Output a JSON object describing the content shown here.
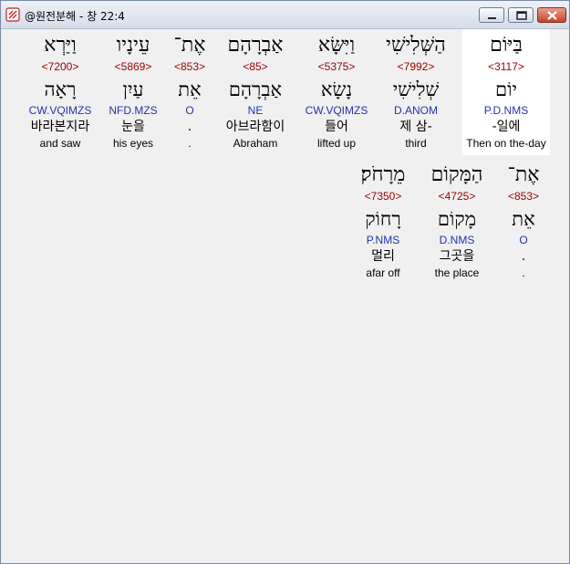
{
  "window": {
    "title": "@원전분해 - 창 22:4"
  },
  "words": [
    {
      "hebrew": "בַּיּוֹם",
      "strong": "<3117>",
      "lemma": "יוֹם",
      "parse": "P.D.NMS",
      "korean": "-일에",
      "english": "Then on the-day",
      "highlight": true
    },
    {
      "hebrew": "הַשְּׁלִישִׁי",
      "strong": "<7992>",
      "lemma": "שְׁלִישִׁי",
      "parse": "D.ANOM",
      "korean": "제 삼-",
      "english": "third"
    },
    {
      "hebrew": "וַיִּשָּׂא",
      "strong": "<5375>",
      "lemma": "נָשָׂא",
      "parse": "CW.VQIMZS",
      "korean": "들어",
      "english": "lifted up"
    },
    {
      "hebrew": "אַבְרָהָם",
      "strong": "<85>",
      "lemma": "אַבְרָהָם",
      "parse": "NE",
      "korean": "아브라함이",
      "english": "Abraham"
    },
    {
      "hebrew": "אֶת־",
      "strong": "<853>",
      "lemma": "אֵת",
      "parse": "O",
      "korean": ".",
      "english": "."
    },
    {
      "hebrew": "עֵינָיו",
      "strong": "<5869>",
      "lemma": "עַיִן",
      "parse": "NFD.MZS",
      "korean": "눈을",
      "english": "his eyes"
    },
    {
      "hebrew": "וַיַּרְא",
      "strong": "<7200>",
      "lemma": "רָאָה",
      "parse": "CW.VQIMZS",
      "korean": "바라본지라",
      "english": "and saw"
    },
    {
      "hebrew": "אֶת־",
      "strong": "<853>",
      "lemma": "אֵת",
      "parse": "O",
      "korean": ".",
      "english": "."
    },
    {
      "hebrew": "הַמָּקוֹם",
      "strong": "<4725>",
      "lemma": "מָקוֹם",
      "parse": "D.NMS",
      "korean": "그곳을",
      "english": "the place"
    },
    {
      "hebrew": "מֵרָחֹק׃",
      "strong": "<7350>",
      "lemma": "רָחוֹק",
      "parse": "P.NMS",
      "korean": "멀리",
      "english": "afar off"
    }
  ],
  "colors": {
    "strong": "#990000",
    "parse": "#2233aa",
    "highlight": "#ffffff",
    "background": "#f0f0f0"
  }
}
